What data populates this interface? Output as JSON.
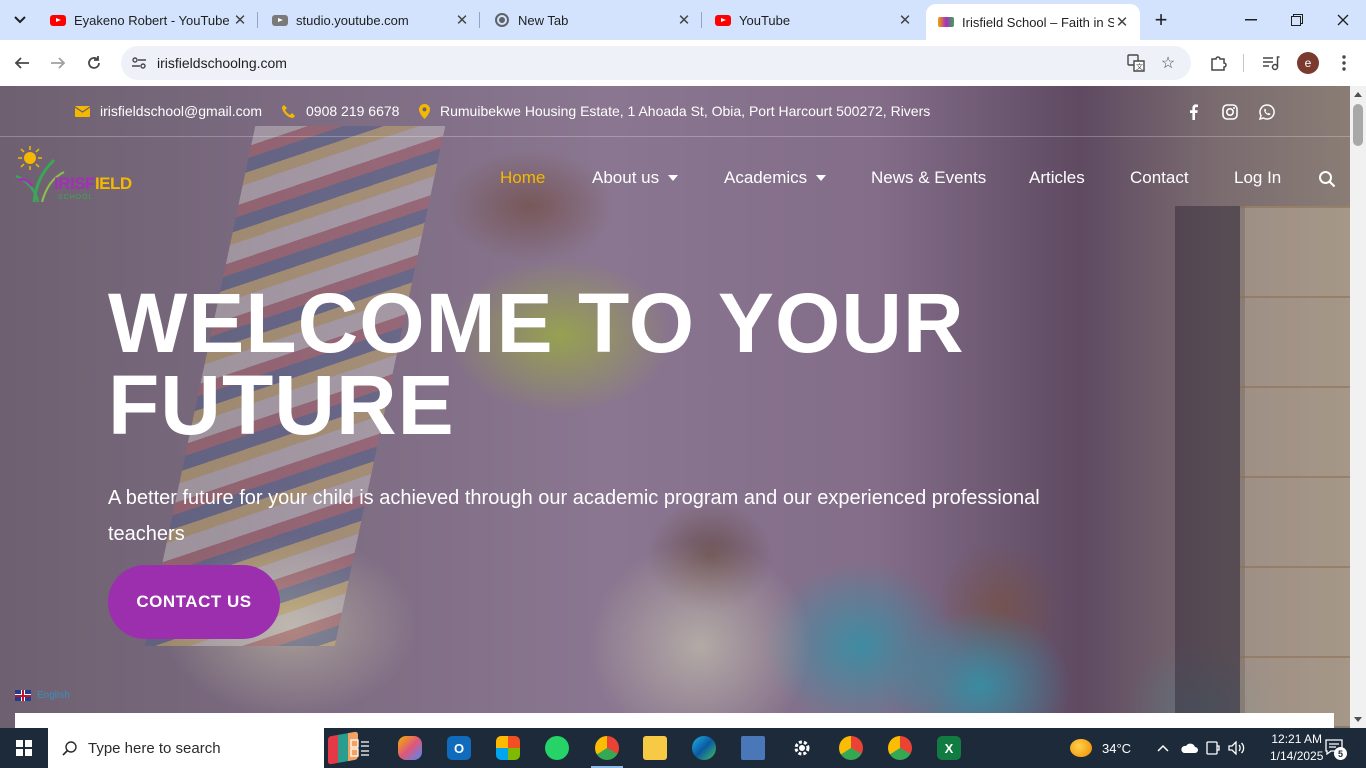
{
  "browser": {
    "tabs": [
      {
        "title": "Eyakeno Robert - YouTube",
        "icon": "youtube-icon"
      },
      {
        "title": "studio.youtube.com",
        "icon": "youtube-studio-icon"
      },
      {
        "title": "New Tab",
        "icon": "chrome-icon"
      },
      {
        "title": "YouTube",
        "icon": "youtube-icon"
      },
      {
        "title": "Irisfield School – Faith in Self",
        "icon": "irisfield-favicon"
      }
    ],
    "url": "irisfieldschoolng.com",
    "profile_initial": "e"
  },
  "site": {
    "topbar": {
      "email": "irisfieldschool@gmail.com",
      "phone": "0908 219 6678",
      "address": "Rumuibekwe Housing Estate, 1 Ahoada St, Obia, Port Harcourt 500272, Rivers"
    },
    "logo": {
      "word_a": "IRISF",
      "word_b": "IELD",
      "sub": "SCHOOL"
    },
    "nav": {
      "home": "Home",
      "about": "About us",
      "academics": "Academics",
      "news": "News & Events",
      "articles": "Articles",
      "contact": "Contact",
      "login": "Log In"
    },
    "hero": {
      "title": "WELCOME TO YOUR FUTURE",
      "subtitle": "A better future for your child is achieved through our academic program and our experienced professional teachers",
      "cta": "CONTACT US"
    },
    "language": "English"
  },
  "taskbar": {
    "search_placeholder": "Type here to search",
    "weather": "34°C",
    "time": "12:21 AM",
    "date": "1/14/2025",
    "notifications": "5"
  },
  "colors": {
    "accent_yellow": "#f5b800",
    "brand_purple": "#9b2fae",
    "tabstrip": "#d3e3fd"
  }
}
